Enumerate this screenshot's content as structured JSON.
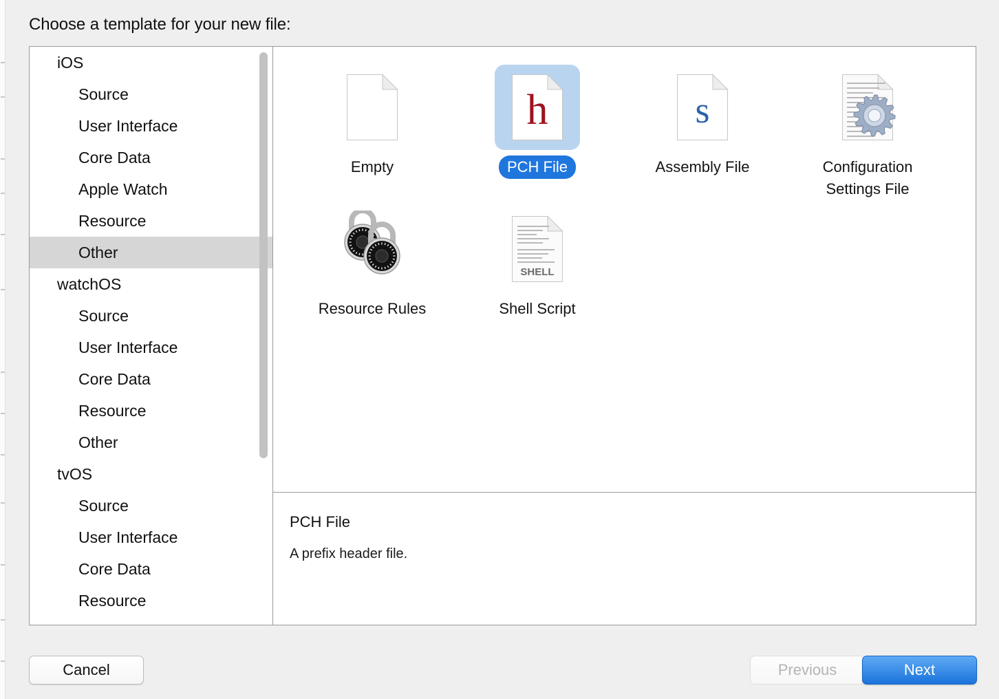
{
  "dialog": {
    "title": "Choose a template for your new file:"
  },
  "sidebar": {
    "items": [
      {
        "label": "iOS",
        "level": "group",
        "selected": false
      },
      {
        "label": "Source",
        "level": "child",
        "selected": false
      },
      {
        "label": "User Interface",
        "level": "child",
        "selected": false
      },
      {
        "label": "Core Data",
        "level": "child",
        "selected": false
      },
      {
        "label": "Apple Watch",
        "level": "child",
        "selected": false
      },
      {
        "label": "Resource",
        "level": "child",
        "selected": false
      },
      {
        "label": "Other",
        "level": "child",
        "selected": true
      },
      {
        "label": "watchOS",
        "level": "group",
        "selected": false
      },
      {
        "label": "Source",
        "level": "child",
        "selected": false
      },
      {
        "label": "User Interface",
        "level": "child",
        "selected": false
      },
      {
        "label": "Core Data",
        "level": "child",
        "selected": false
      },
      {
        "label": "Resource",
        "level": "child",
        "selected": false
      },
      {
        "label": "Other",
        "level": "child",
        "selected": false
      },
      {
        "label": "tvOS",
        "level": "group",
        "selected": false
      },
      {
        "label": "Source",
        "level": "child",
        "selected": false
      },
      {
        "label": "User Interface",
        "level": "child",
        "selected": false
      },
      {
        "label": "Core Data",
        "level": "child",
        "selected": false
      },
      {
        "label": "Resource",
        "level": "child",
        "selected": false
      }
    ],
    "selected_label": "Other"
  },
  "templates": [
    {
      "label": "Empty",
      "icon": "blank-document-icon",
      "selected": false
    },
    {
      "label": "PCH File",
      "icon": "h-header-document-icon",
      "selected": true
    },
    {
      "label": "Assembly File",
      "icon": "s-assembly-document-icon",
      "selected": false
    },
    {
      "label": "Configuration Settings File",
      "icon": "gear-document-icon",
      "selected": false
    },
    {
      "label": "Resource Rules",
      "icon": "padlocks-icon",
      "selected": false
    },
    {
      "label": "Shell Script",
      "icon": "shell-script-document-icon",
      "selected": false
    }
  ],
  "detail": {
    "title": "PCH File",
    "description": "A prefix header file."
  },
  "footer": {
    "cancel_label": "Cancel",
    "previous_label": "Previous",
    "next_label": "Next"
  },
  "icon_text": {
    "pch_glyph": "h",
    "assembly_glyph": "s",
    "shell_label": "SHELL"
  },
  "colors": {
    "selection_blue": "#1f76dd",
    "selection_tile": "#b9d4ef",
    "sidebar_selection": "#d6d6d6",
    "pch_glyph": "#9e1320",
    "assembly_glyph": "#2a63a8",
    "next_button": "#1a73db"
  }
}
